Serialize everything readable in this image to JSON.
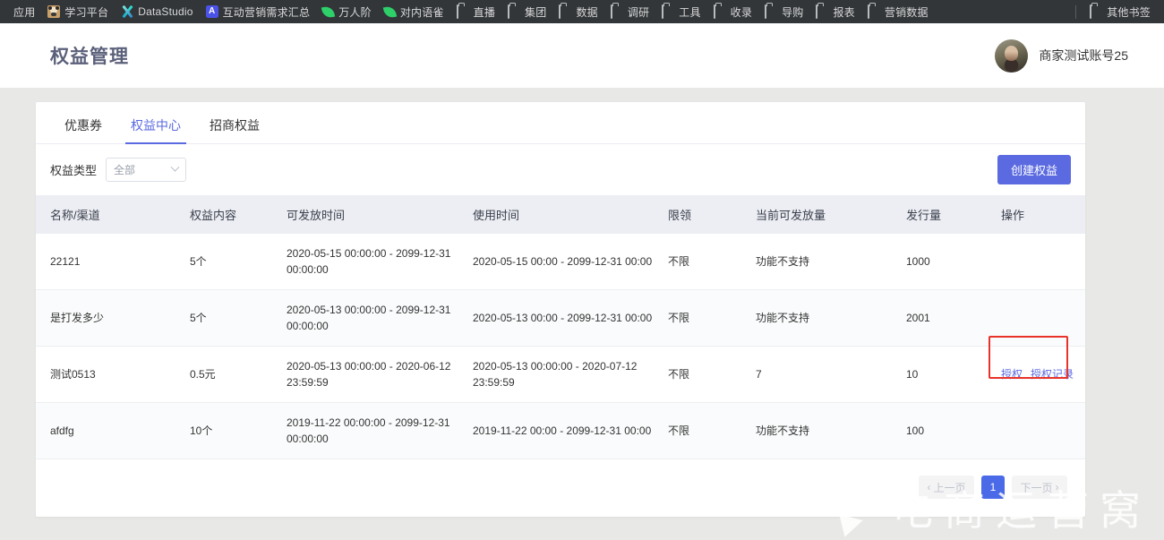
{
  "browser": {
    "bookmarks": [
      {
        "label": "应用",
        "icon": "none"
      },
      {
        "label": "学习平台",
        "icon": "panda-icon"
      },
      {
        "label": "DataStudio",
        "icon": "x-logo-icon"
      },
      {
        "label": "互动营销需求汇总",
        "icon": "square-a-icon"
      },
      {
        "label": "万人阶",
        "icon": "leaf-icon"
      },
      {
        "label": "对内语雀",
        "icon": "leaf-icon"
      },
      {
        "label": "直播",
        "icon": "folder-icon"
      },
      {
        "label": "集团",
        "icon": "folder-icon"
      },
      {
        "label": "数据",
        "icon": "folder-icon"
      },
      {
        "label": "调研",
        "icon": "folder-icon"
      },
      {
        "label": "工具",
        "icon": "folder-icon"
      },
      {
        "label": "收录",
        "icon": "folder-icon"
      },
      {
        "label": "导购",
        "icon": "folder-icon"
      },
      {
        "label": "报表",
        "icon": "folder-icon"
      },
      {
        "label": "营销数据",
        "icon": "folder-icon"
      }
    ],
    "other_bookmarks": {
      "label": "其他书签",
      "icon": "folder-icon"
    }
  },
  "header": {
    "title": "权益管理",
    "user_name": "商家测试账号25"
  },
  "tabs": [
    {
      "label": "优惠券",
      "active": false
    },
    {
      "label": "权益中心",
      "active": true
    },
    {
      "label": "招商权益",
      "active": false
    }
  ],
  "filter": {
    "label": "权益类型",
    "select_value": "全部",
    "chevron": "chevron-down-icon"
  },
  "toolbar": {
    "create_label": "创建权益"
  },
  "table": {
    "columns": [
      "名称/渠道",
      "权益内容",
      "可发放时间",
      "使用时间",
      "限领",
      "当前可发放量",
      "发行量",
      "操作"
    ],
    "rows": [
      {
        "name": "22121",
        "content": "5个",
        "issue_time": "2020-05-15 00:00:00 - 2099-12-31 00:00:00",
        "use_time": "2020-05-15 00:00 - 2099-12-31 00:00",
        "limit": "不限",
        "available": "功能不支持",
        "total": "1000",
        "ops": []
      },
      {
        "name": "是打发多少",
        "content": "5个",
        "issue_time": "2020-05-13 00:00:00 - 2099-12-31 00:00:00",
        "use_time": "2020-05-13 00:00 - 2099-12-31 00:00",
        "limit": "不限",
        "available": "功能不支持",
        "total": "2001",
        "ops": []
      },
      {
        "name": "测试0513",
        "content": "0.5元",
        "issue_time": "2020-05-13 00:00:00 - 2020-06-12 23:59:59",
        "use_time": "2020-05-13 00:00:00 - 2020-07-12 23:59:59",
        "limit": "不限",
        "available": "7",
        "total": "10",
        "ops": [
          "授权",
          "授权记录"
        ],
        "highlighted": true
      },
      {
        "name": "afdfg",
        "content": "10个",
        "issue_time": "2019-11-22 00:00:00 - 2099-12-31 00:00:00",
        "use_time": "2019-11-22 00:00 - 2099-12-31 00:00",
        "limit": "不限",
        "available": "功能不支持",
        "total": "100",
        "ops": []
      }
    ]
  },
  "pagination": {
    "prev_label": "上一页",
    "current_page": "1",
    "next_label": "下一页"
  },
  "watermark": {
    "text": "电商运营窝"
  },
  "colors": {
    "accent": "#5b6ae0",
    "highlight": "#e8332a",
    "header_bg": "#eceef3",
    "page_bg": "#e8e8e6",
    "bookmark_bar": "#323639"
  }
}
